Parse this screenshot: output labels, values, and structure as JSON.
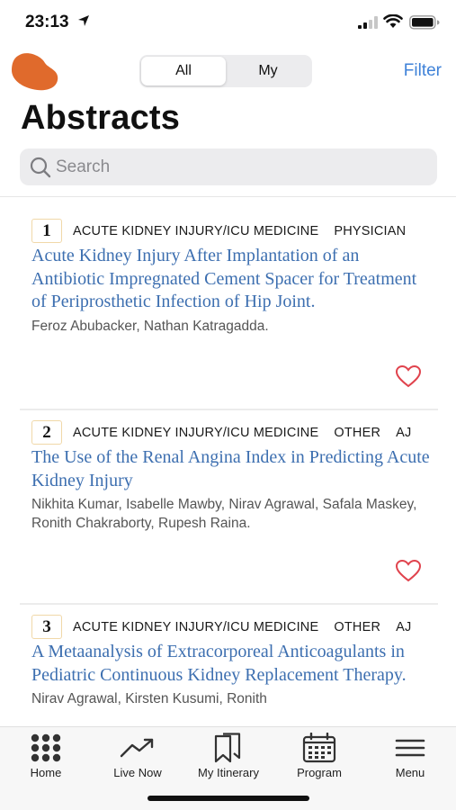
{
  "status": {
    "time": "23:13"
  },
  "header": {
    "segments": [
      {
        "label": "All",
        "selected": true
      },
      {
        "label": "My",
        "selected": false
      }
    ],
    "filter_label": "Filter",
    "title": "Abstracts"
  },
  "search": {
    "placeholder": "Search"
  },
  "abstracts": [
    {
      "number": "1",
      "tags": [
        "ACUTE KIDNEY INJURY/ICU MEDICINE",
        "PHYSICIAN"
      ],
      "title": "Acute Kidney Injury After Implantation of an Antibiotic Impregnated Cement Spacer for Treatment of Periprosthetic Infection of Hip Joint.",
      "authors": "Feroz Abubacker, Nathan Katragadda."
    },
    {
      "number": "2",
      "tags": [
        "ACUTE KIDNEY INJURY/ICU MEDICINE",
        "OTHER",
        "AJ"
      ],
      "title": "The Use of the Renal Angina Index in Predicting Acute Kidney Injury",
      "authors": "Nikhita Kumar, Isabelle Mawby, Nirav Agrawal, Safala Maskey, Ronith Chakraborty, Rupesh Raina."
    },
    {
      "number": "3",
      "tags": [
        "ACUTE KIDNEY INJURY/ICU MEDICINE",
        "OTHER",
        "AJ"
      ],
      "title": "A Metaanalysis of Extracorporeal Anticoagulants in Pediatric Continuous Kidney Replacement Therapy.",
      "authors": "Nirav Agrawal, Kirsten Kusumi, Ronith"
    }
  ],
  "tabbar": [
    {
      "label": "Home",
      "icon": "grid-icon"
    },
    {
      "label": "Live Now",
      "icon": "trending-icon"
    },
    {
      "label": "My Itinerary",
      "icon": "bookmarks-icon"
    },
    {
      "label": "Program",
      "icon": "calendar-icon"
    },
    {
      "label": "Menu",
      "icon": "menu-icon"
    }
  ],
  "colors": {
    "accent": "#3f82d8",
    "title_link": "#3d6fb0",
    "heart": "#e0434d",
    "logo": "#e06a2c"
  }
}
